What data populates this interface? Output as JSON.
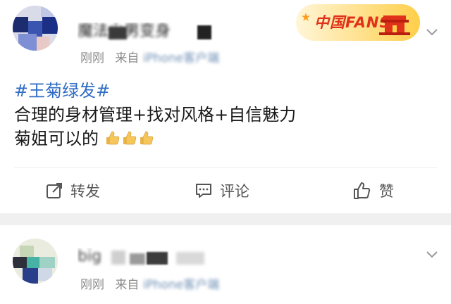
{
  "posts": [
    {
      "username": "魔法少男变身",
      "time": "刚刚",
      "source_prefix": "来自",
      "source": "iPhone客户端",
      "badge": {
        "text": "中国FANS"
      },
      "hashtag": "#王菊绿发#",
      "lines": [
        "合理的身材管理+找对风格+自信魅力",
        "菊姐可以的"
      ],
      "emoji": [
        "thumbs-up-icon",
        "thumbs-up-icon",
        "thumbs-up-icon"
      ],
      "actions": {
        "repost": "转发",
        "comment": "评论",
        "like": "赞"
      }
    },
    {
      "username": "big",
      "time": "刚刚",
      "source_prefix": "来自",
      "source": "iPhone客户端"
    }
  ],
  "colors": {
    "hashtag": "#2f6dc4",
    "meta": "#8a8a8a",
    "badge_text": "#e0321a"
  }
}
